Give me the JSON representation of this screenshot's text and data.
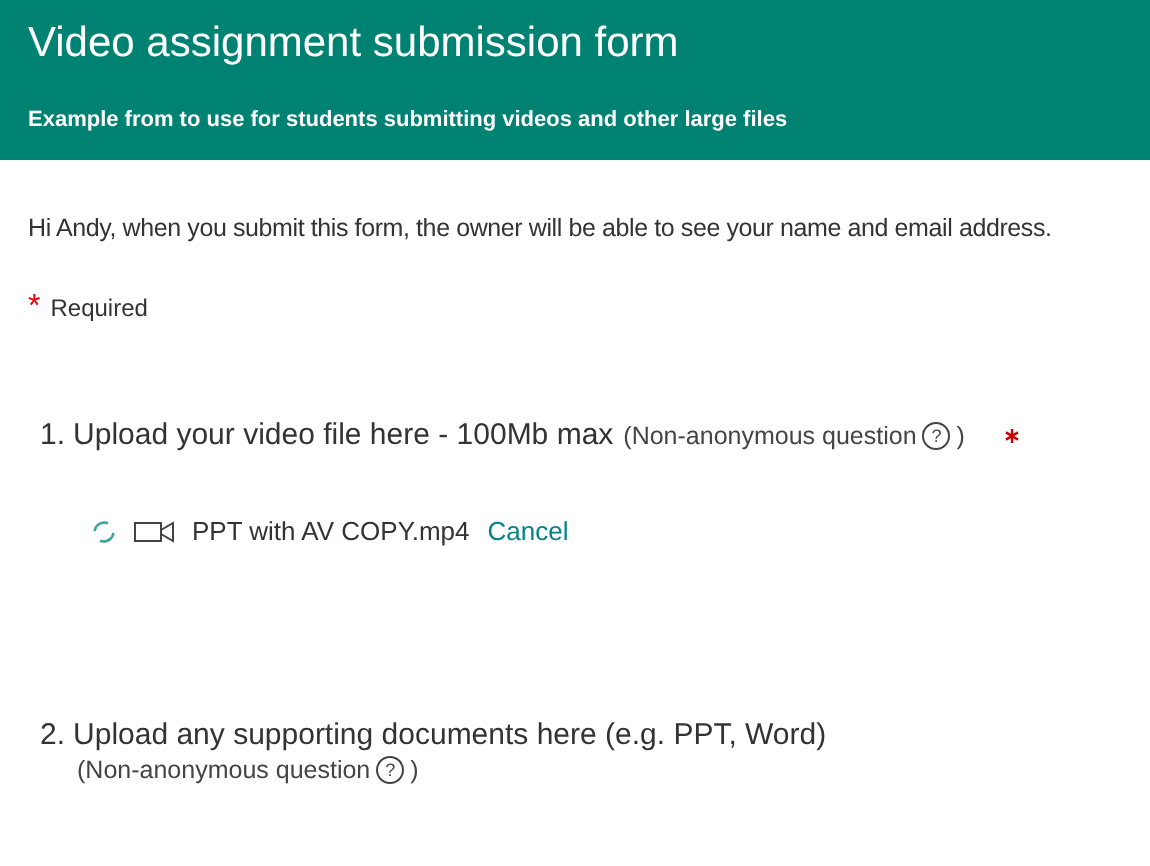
{
  "header": {
    "title": "Video assignment submission form",
    "subtitle": "Example from to use for students submitting videos and other large files"
  },
  "notice": "Hi Andy, when you submit this form, the owner will be able to see your name and email address.",
  "required_legend": {
    "mark": "*",
    "label": "Required"
  },
  "questions": [
    {
      "number": "1.",
      "title": "Upload your video file here - 100Mb max",
      "note": "(Non-anonymous question",
      "help": "?",
      "note_end": ")",
      "required": true,
      "upload": {
        "file_name": "PPT with AV COPY.mp4",
        "action": "Cancel"
      }
    },
    {
      "number": "2.",
      "title": "Upload any supporting documents here (e.g. PPT, Word)",
      "note": "(Non-anonymous question",
      "help": "?",
      "note_end": ")",
      "required": false
    }
  ]
}
